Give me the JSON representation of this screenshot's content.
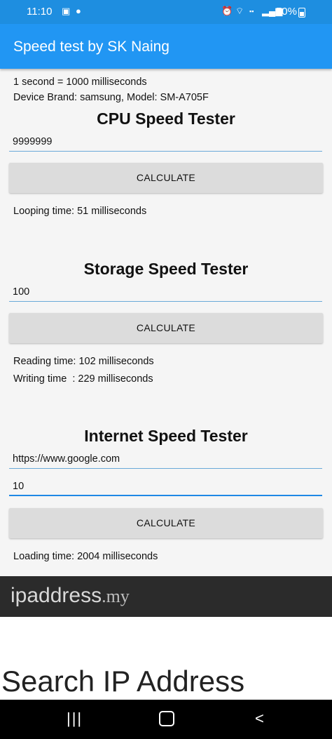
{
  "status_bar": {
    "time": "11:10",
    "battery": "50%"
  },
  "app_bar": {
    "title": "Speed test by SK Naing"
  },
  "info": {
    "line1": "1 second = 1000 milliseconds",
    "line2": "Device Brand: samsung, Model: SM-A705F"
  },
  "cpu": {
    "heading": "CPU Speed Tester",
    "input_value": "9999999",
    "button_label": "CALCULATE",
    "result": "Looping time: 51 milliseconds"
  },
  "storage": {
    "heading": "Storage Speed Tester",
    "input_value": "100",
    "button_label": "CALCULATE",
    "reading": "Reading time: 102 milliseconds",
    "writing": "Writing time  : 229 milliseconds"
  },
  "internet": {
    "heading": "Internet Speed Tester",
    "url_value": "https://www.google.com",
    "count_value": "10",
    "button_label": "CALCULATE",
    "result": "Loading time: 2004 milliseconds"
  },
  "ad": {
    "logo_name": "ipaddress",
    "logo_tld": ".my"
  },
  "web": {
    "heading": "Search IP Address"
  },
  "nav": {
    "recents": "|||",
    "back": "<"
  },
  "colors": {
    "status_bar": "#1e8ee0",
    "app_bar": "#2196f3",
    "button": "#dcdcdc",
    "ad_banner": "#2b2b2b"
  }
}
